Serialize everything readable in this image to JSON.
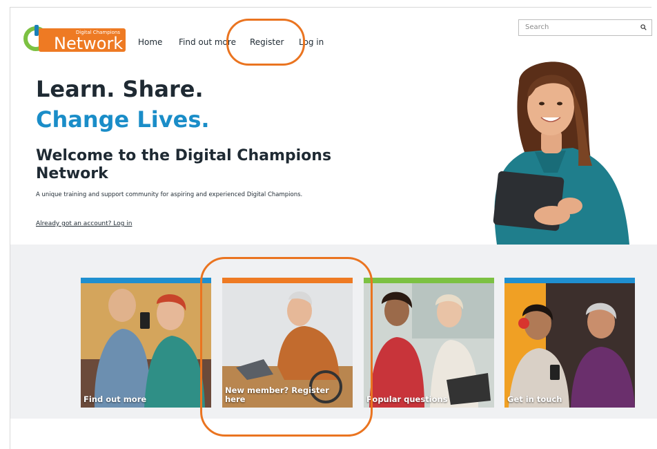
{
  "header": {
    "logo": {
      "top_text": "Digital Champions",
      "main_text": "Network"
    },
    "nav": [
      "Home",
      "Find out more",
      "Register",
      "Log in"
    ],
    "search": {
      "placeholder": "Search",
      "icon": "search-icon"
    }
  },
  "hero": {
    "line1": "Learn. Share.",
    "line2": "Change Lives.",
    "heading": "Welcome to the Digital Champions Network",
    "lead": "A unique training and support community for aspiring and experienced Digital Champions.",
    "login_link": "Already got an account? Log in"
  },
  "cards": [
    {
      "caption": "Find out more",
      "bar_color": "#1f8fd0"
    },
    {
      "caption": "New member? Register here",
      "bar_color": "#ee7a23"
    },
    {
      "caption": "Popular questions",
      "bar_color": "#7cc142"
    },
    {
      "caption": "Get in touch",
      "bar_color": "#1f8fd0"
    }
  ],
  "colors": {
    "accent_blue": "#1a8dc8",
    "brand_orange": "#ee7a23",
    "brand_green": "#7cc142",
    "highlight": "#ea7420"
  }
}
